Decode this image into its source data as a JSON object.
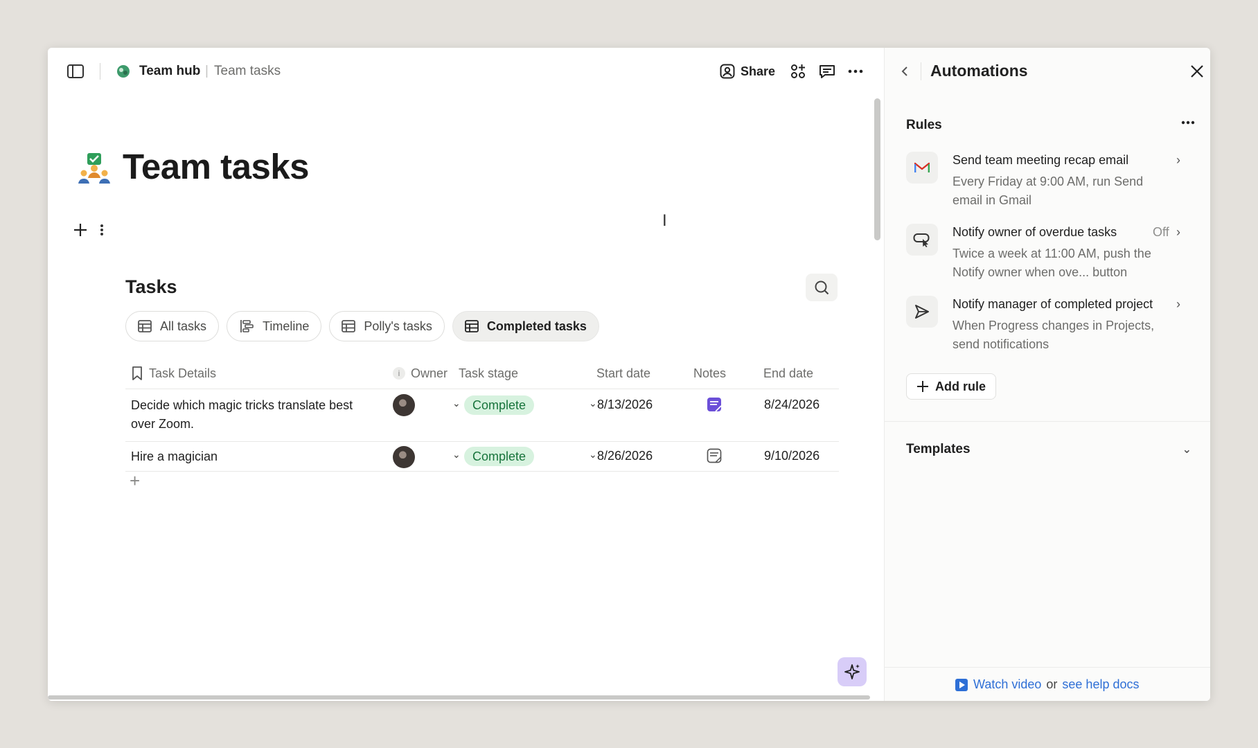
{
  "topbar": {
    "hub_name": "Team hub",
    "separator": "|",
    "page_name": "Team tasks",
    "share_label": "Share"
  },
  "page": {
    "title": "Team tasks"
  },
  "tasks": {
    "heading": "Tasks",
    "tabs": [
      {
        "label": "All tasks",
        "icon": "table-icon",
        "active": false
      },
      {
        "label": "Timeline",
        "icon": "timeline-icon",
        "active": false
      },
      {
        "label": "Polly's tasks",
        "icon": "table-icon",
        "active": false
      },
      {
        "label": "Completed tasks",
        "icon": "table-icon",
        "active": true
      }
    ],
    "columns": [
      "Task Details",
      "Owner",
      "Task stage",
      "Start date",
      "Notes",
      "End date"
    ],
    "rows": [
      {
        "task": "Decide which magic tricks translate best over Zoom.",
        "stage": "Complete",
        "start": "8/13/2026",
        "notes": "filled",
        "end": "8/24/2026"
      },
      {
        "task": "Hire a magician",
        "stage": "Complete",
        "start": "8/26/2026",
        "notes": "empty",
        "end": "9/10/2026"
      }
    ]
  },
  "panel": {
    "title": "Automations",
    "rules_label": "Rules",
    "rules": [
      {
        "title": "Send team meeting recap email",
        "desc": "Every Friday at 9:00 AM, run Send email in Gmail",
        "status": "",
        "icon": "gmail-icon"
      },
      {
        "title": "Notify owner of overdue tasks",
        "desc": "Twice a week at 11:00 AM, push the Notify owner when ove... button",
        "status": "Off",
        "icon": "button-icon"
      },
      {
        "title": "Notify manager of completed project",
        "desc": "When Progress changes in Projects, send notifications",
        "status": "",
        "icon": "send-icon"
      }
    ],
    "add_rule_label": "Add rule",
    "templates_label": "Templates",
    "footer": {
      "watch_video": "Watch video",
      "or": "or",
      "help_docs": "see help docs"
    }
  },
  "colors": {
    "accent_link": "#2e6fd6",
    "pill_bg": "#d7f2df",
    "pill_text": "#18743c",
    "notes_filled": "#6b4fd8",
    "ai_button": "#d8cdf8"
  }
}
